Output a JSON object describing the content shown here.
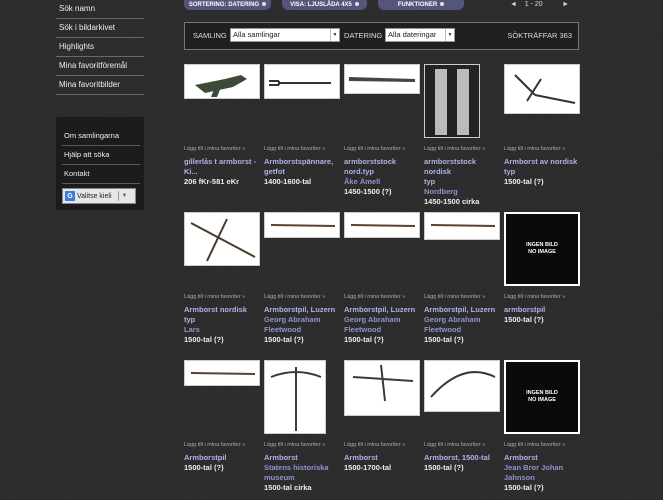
{
  "nav_primary": [
    "Sök namn",
    "Sök i bildarkivet",
    "Highlights",
    "Mina favoritföremål",
    "Mina favoritbilder"
  ],
  "nav_secondary": [
    "Om samlingarna",
    "Hjälp att söka",
    "Kontakt"
  ],
  "translate": {
    "label": "Valitse kieli"
  },
  "toolbar": {
    "sort_label": "SORTERING: DATERING",
    "view_label": "VISA: LJUSLÅDA 4X5",
    "functions_label": "FUNKTIONER",
    "prev": "◄",
    "range": "1 - 20",
    "next": "►"
  },
  "filter": {
    "collection_label": "SAMLING",
    "collection_value": "Alla samlingar",
    "dating_label": "DATERING",
    "dating_value": "Alla dateringar",
    "hits_label": "SÖKTRÄFFAR 363"
  },
  "fav_link": "Lägg till i mina favoriter »",
  "no_image": [
    "INGEN BILD",
    "NO IMAGE"
  ],
  "items": [
    {
      "title": [
        "gillerlås t armborst -",
        "Ki..."
      ],
      "maker": [],
      "date": [
        "206 fKr-581 eKr"
      ]
    },
    {
      "title": [
        "Armborstspännare,",
        "getfot"
      ],
      "maker": [],
      "date": [
        "1400-1600-tal"
      ]
    },
    {
      "title": [
        "armborststock",
        "nord.typ"
      ],
      "maker": [
        "Åke Ämell"
      ],
      "date": [
        "1450-1500 (?)"
      ]
    },
    {
      "title": [
        "armborststock nordisk",
        "typ"
      ],
      "maker": [
        "Nordberg"
      ],
      "date": [
        "1450-1500 cirka"
      ]
    },
    {
      "title": [
        "Armborst av nordisk",
        "typ"
      ],
      "maker": [],
      "date": [
        "1500-tal (?)"
      ]
    },
    {
      "title": [
        "Armborst nordisk typ"
      ],
      "maker": [
        "Lars"
      ],
      "date": [
        "1500-tal (?)"
      ]
    },
    {
      "title": [
        "Armborstpil, Luzern"
      ],
      "maker": [
        "Georg Abraham",
        "Fleetwood"
      ],
      "date": [
        "1500-tal (?)"
      ]
    },
    {
      "title": [
        "Armborstpil, Luzern"
      ],
      "maker": [
        "Georg Abraham",
        "Fleetwood"
      ],
      "date": [
        "1500-tal (?)"
      ]
    },
    {
      "title": [
        "Armborstpil, Luzern"
      ],
      "maker": [
        "Georg Abraham",
        "Fleetwood"
      ],
      "date": [
        "1500-tal (?)"
      ]
    },
    {
      "title": [
        "armborstpil"
      ],
      "maker": [],
      "date": [
        "1500-tal (?)"
      ]
    },
    {
      "title": [
        "Armborstpil"
      ],
      "maker": [],
      "date": [
        "1500-tal (?)"
      ]
    },
    {
      "title": [
        "Armborst"
      ],
      "maker": [
        "Statens historiska",
        "museum"
      ],
      "date": [
        "1500-tal cirka"
      ]
    },
    {
      "title": [
        "Armborst"
      ],
      "maker": [],
      "date": [
        "1500-1700-tal"
      ]
    },
    {
      "title": [
        "Armborst, 1500-tal"
      ],
      "maker": [],
      "date": [
        "1500-tal (?)"
      ]
    },
    {
      "title": [
        "Armborst"
      ],
      "maker": [
        "Jean Bror Johan",
        "Jahnson"
      ],
      "date": [
        "1500-tal (?)"
      ]
    }
  ]
}
